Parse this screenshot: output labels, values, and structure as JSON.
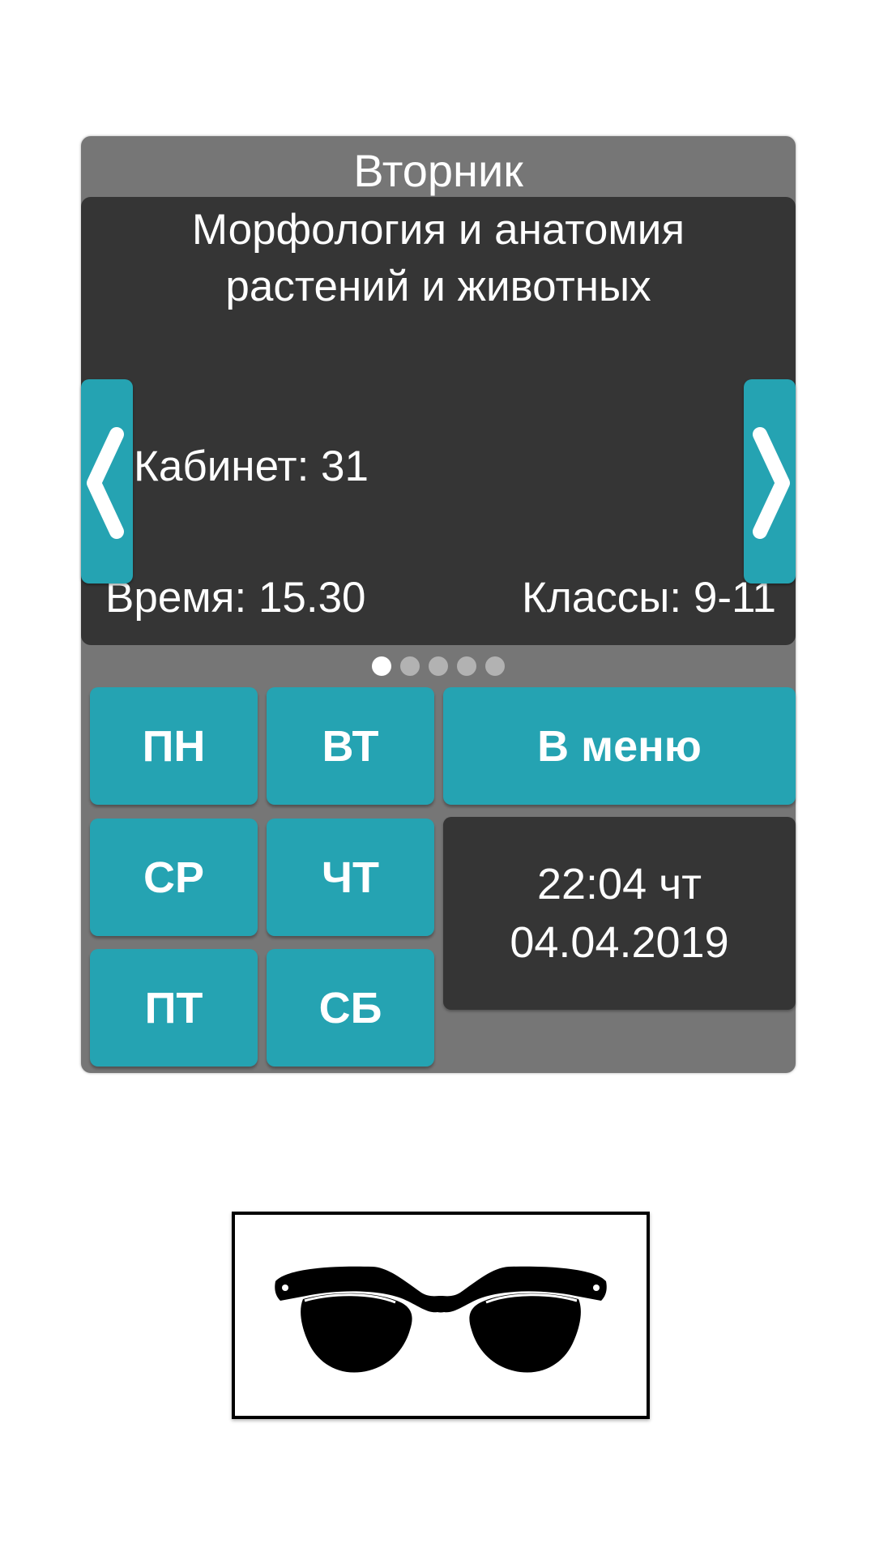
{
  "schedule": {
    "day_title": "Вторник",
    "lesson": {
      "title": "Морфология и анатомия растений и животных",
      "room": "Кабинет: 31",
      "time": "Время: 15.30",
      "classes": "Классы: 9-11"
    },
    "pager": {
      "pages": 5,
      "active": 1
    },
    "nav": {
      "prev_icon": "chevron-left-icon",
      "next_icon": "chevron-right-icon"
    }
  },
  "day_buttons": {
    "mon": "ПН",
    "tue": "ВТ",
    "wed": "СР",
    "thu": "ЧТ",
    "fri": "ПТ",
    "sat": "СБ"
  },
  "menu_button": "В меню",
  "clock": {
    "time_line": "22:04 чт",
    "date_line": "04.04.2019"
  },
  "logo": {
    "icon": "sunglasses-icon"
  },
  "colors": {
    "accent": "#25a3b2",
    "panel": "#767676",
    "card": "#353535",
    "dot_inactive": "#b2b2b2",
    "dot_active": "#ffffff"
  }
}
